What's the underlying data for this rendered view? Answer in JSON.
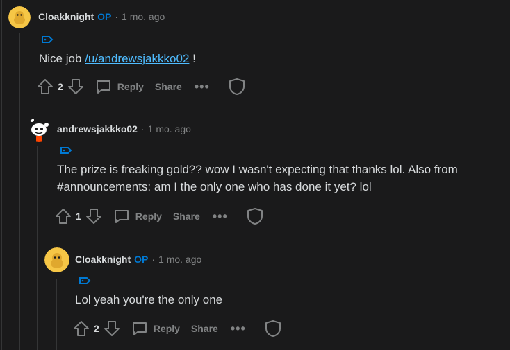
{
  "comments": [
    {
      "author": "Cloakknight",
      "op_badge": "OP",
      "separator": "·",
      "time": "1 mo. ago",
      "body_prefix": "Nice job ",
      "body_link": "/u/andrewsjakkko02",
      "body_suffix": " !",
      "votes": "2",
      "reply_label": "Reply",
      "share_label": "Share",
      "more_label": "•••"
    },
    {
      "author": "andrewsjakkko02",
      "separator": "·",
      "time": "1 mo. ago",
      "body_line1": "The prize is freaking gold?? wow I wasn't expecting that thanks lol. Also from",
      "body_line2": "#announcements: am I the only one who has done it yet? lol",
      "votes": "1",
      "reply_label": "Reply",
      "share_label": "Share",
      "more_label": "•••"
    },
    {
      "author": "Cloakknight",
      "op_badge": "OP",
      "separator": "·",
      "time": "1 mo. ago",
      "body": "Lol yeah you're the only one",
      "votes": "2",
      "reply_label": "Reply",
      "share_label": "Share",
      "more_label": "•••"
    }
  ],
  "colors": {
    "background": "#1a1a1b",
    "text": "#d7dadc",
    "muted": "#818384",
    "op": "#0079d3",
    "link": "#4fbcff",
    "avatar_yellow": "#f6c646"
  }
}
